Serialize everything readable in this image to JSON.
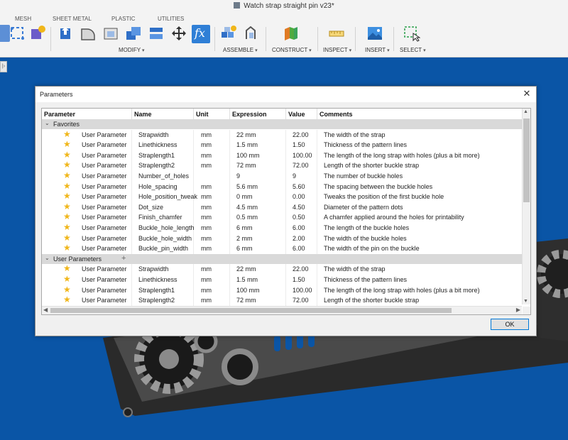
{
  "app": {
    "document_title": "Watch strap straight pin v23*"
  },
  "toolbar": {
    "tabs": [
      "MESH",
      "SHEET METAL",
      "PLASTIC",
      "UTILITIES"
    ],
    "groups": {
      "modify": "MODIFY",
      "assemble": "ASSEMBLE",
      "construct": "CONSTRUCT",
      "inspect": "INSPECT",
      "insert": "INSERT",
      "select": "SELECT"
    },
    "icons": {
      "sketch": "sketch-icon",
      "create_form": "create-form-icon",
      "press_pull": "press-pull-icon",
      "fillet": "fillet-icon",
      "shell": "shell-icon",
      "combine": "combine-icon",
      "align": "align-icon",
      "move": "move-icon",
      "parameters": "fx-icon",
      "new_component": "new-component-icon",
      "joint": "joint-icon",
      "construct": "offset-plane-icon",
      "measure": "measure-icon",
      "insert": "insert-image-icon",
      "select": "select-window-icon"
    },
    "fx_glyph": "fx"
  },
  "browser": {
    "toggle_glyph": "|›"
  },
  "dialog": {
    "title": "Parameters",
    "close_glyph": "✕",
    "ok_label": "OK",
    "columns": [
      "Parameter",
      "Name",
      "Unit",
      "Expression",
      "Value",
      "Comments"
    ],
    "groups": [
      {
        "label": "Favorites",
        "rows": [
          {
            "parameter": "User Parameter",
            "name": "Strapwidth",
            "unit": "mm",
            "expression": "22 mm",
            "value": "22.00",
            "comment": "The width of the strap"
          },
          {
            "parameter": "User Parameter",
            "name": "Linethickness",
            "unit": "mm",
            "expression": "1.5 mm",
            "value": "1.50",
            "comment": "Thickness of the pattern lines"
          },
          {
            "parameter": "User Parameter",
            "name": "Straplength1",
            "unit": "mm",
            "expression": "100 mm",
            "value": "100.00",
            "comment": "The length of the long strap with holes (plus a bit more)"
          },
          {
            "parameter": "User Parameter",
            "name": "Straplength2",
            "unit": "mm",
            "expression": "72 mm",
            "value": "72.00",
            "comment": "Length of the shorter buckle strap"
          },
          {
            "parameter": "User Parameter",
            "name": "Number_of_holes",
            "unit": "",
            "expression": "9",
            "value": "9",
            "comment": "The number of buckle holes"
          },
          {
            "parameter": "User Parameter",
            "name": "Hole_spacing",
            "unit": "mm",
            "expression": "5.6 mm",
            "value": "5.60",
            "comment": "The spacing between the buckle holes"
          },
          {
            "parameter": "User Parameter",
            "name": "Hole_position_tweak",
            "unit": "mm",
            "expression": "0 mm",
            "value": "0.00",
            "comment": "Tweaks the position of the first buckle hole"
          },
          {
            "parameter": "User Parameter",
            "name": "Dot_size",
            "unit": "mm",
            "expression": "4.5 mm",
            "value": "4.50",
            "comment": "Diameter of the pattern dots"
          },
          {
            "parameter": "User Parameter",
            "name": "Finish_chamfer",
            "unit": "mm",
            "expression": "0.5 mm",
            "value": "0.50",
            "comment": "A chamfer applied around the holes for printability"
          },
          {
            "parameter": "User Parameter",
            "name": "Buckle_hole_length",
            "unit": "mm",
            "expression": "6 mm",
            "value": "6.00",
            "comment": "The length of the buckle holes"
          },
          {
            "parameter": "User Parameter",
            "name": "Buckle_hole_width",
            "unit": "mm",
            "expression": "2 mm",
            "value": "2.00",
            "comment": "The width of the buckle holes"
          },
          {
            "parameter": "User Parameter",
            "name": "Buckle_pin_width",
            "unit": "mm",
            "expression": "6 mm",
            "value": "6.00",
            "comment": "The width of the pin on the buckle"
          }
        ]
      },
      {
        "label": "User Parameters",
        "rows": [
          {
            "parameter": "User Parameter",
            "name": "Strapwidth",
            "unit": "mm",
            "expression": "22 mm",
            "value": "22.00",
            "comment": "The width of the strap"
          },
          {
            "parameter": "User Parameter",
            "name": "Linethickness",
            "unit": "mm",
            "expression": "1.5 mm",
            "value": "1.50",
            "comment": "Thickness of the pattern lines"
          },
          {
            "parameter": "User Parameter",
            "name": "Straplength1",
            "unit": "mm",
            "expression": "100 mm",
            "value": "100.00",
            "comment": "The length of the long strap with holes (plus a bit more)"
          },
          {
            "parameter": "User Parameter",
            "name": "Straplength2",
            "unit": "mm",
            "expression": "72 mm",
            "value": "72.00",
            "comment": "Length of the shorter buckle strap"
          }
        ]
      }
    ]
  },
  "colors": {
    "viewport_bg": "#0a55a6",
    "star": "#f0b619",
    "group_row": "#d9d9d9",
    "accent": "#0078d7"
  }
}
